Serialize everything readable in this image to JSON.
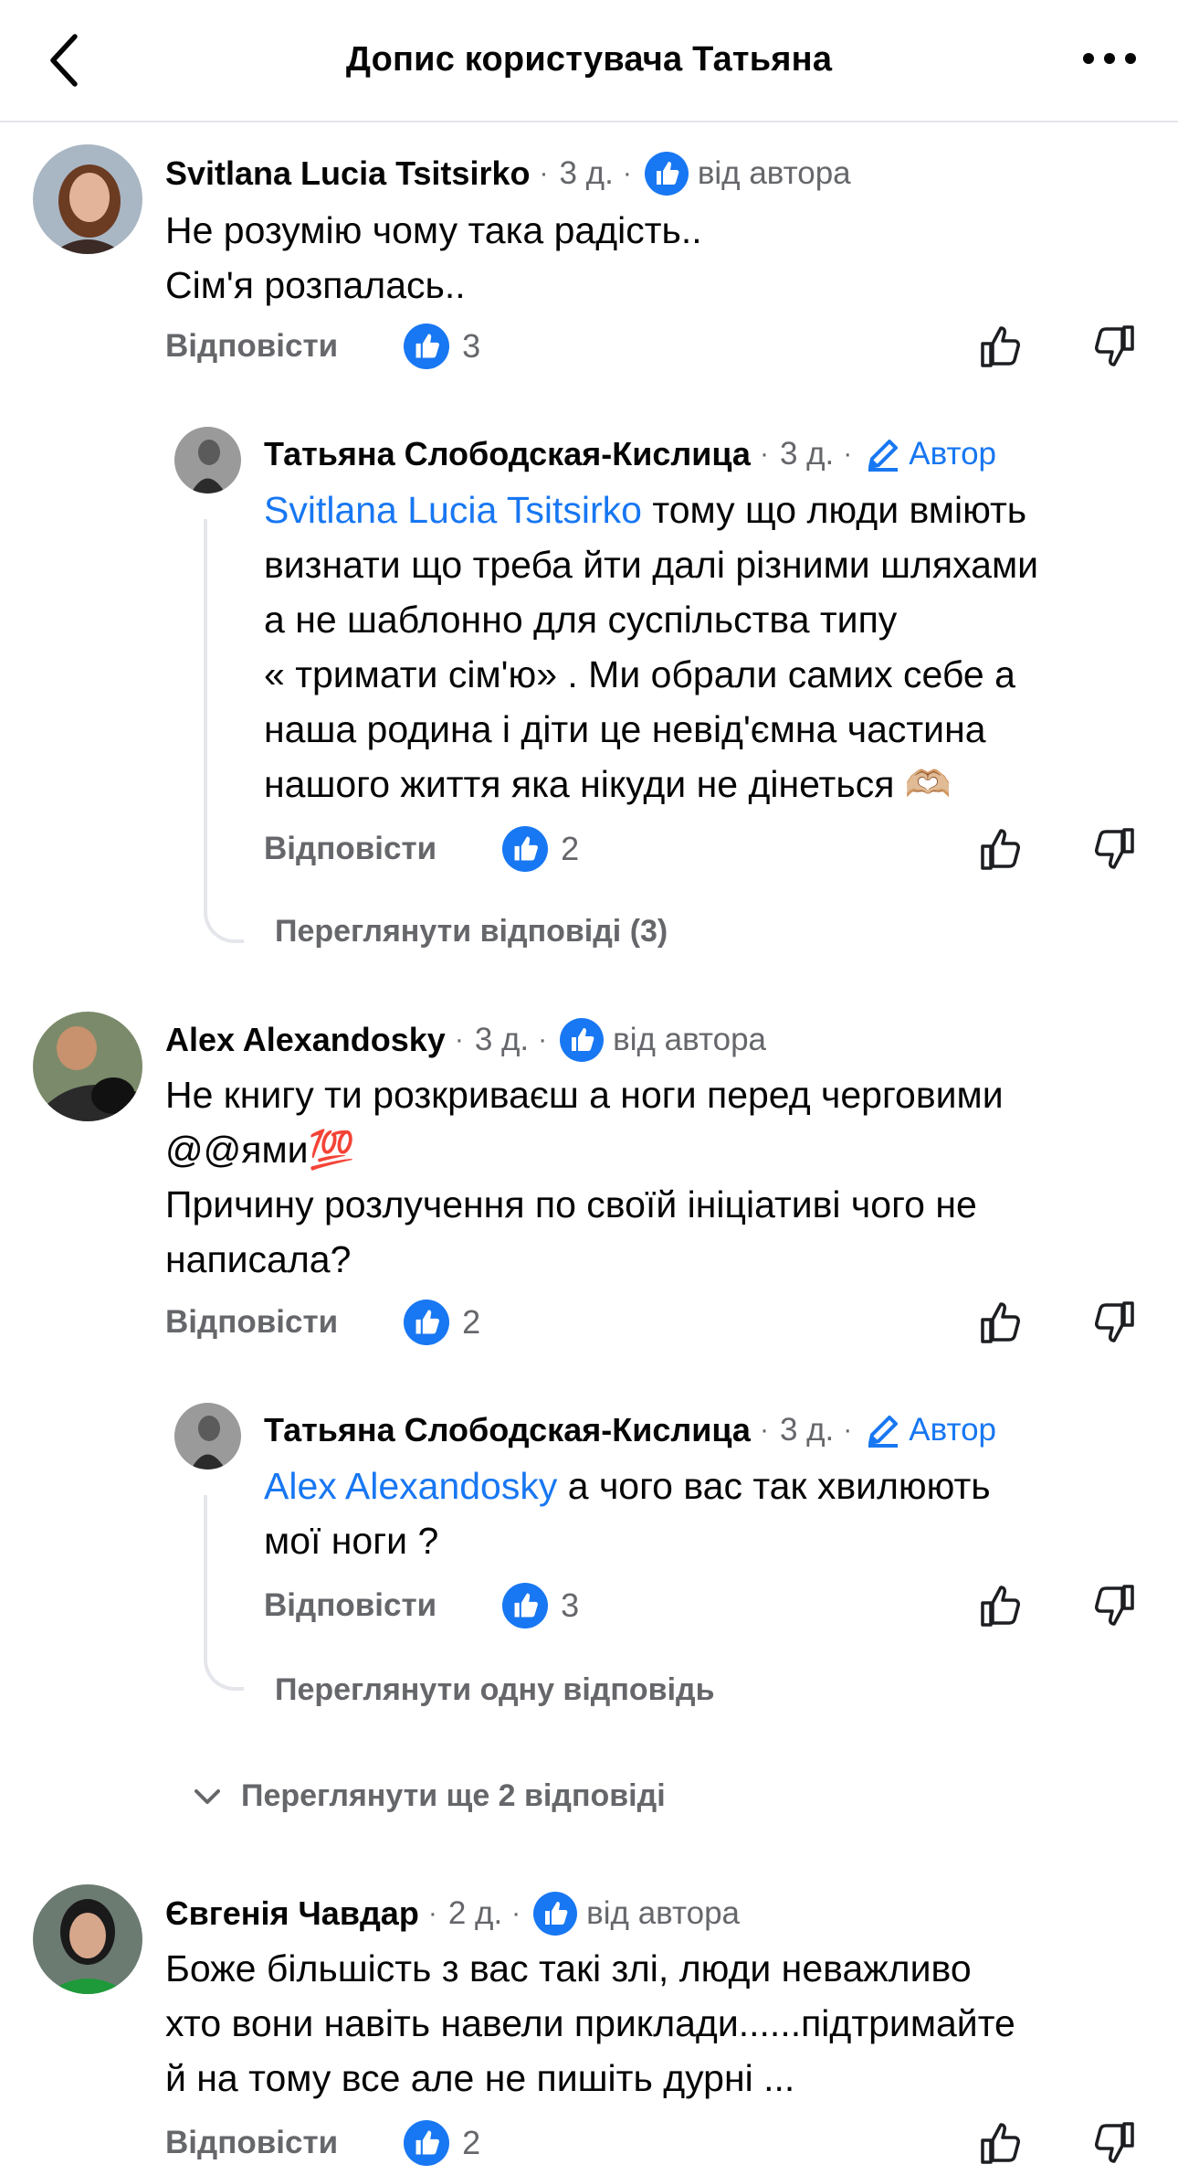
{
  "header": {
    "title": "Допис користувача Татьяна"
  },
  "labels": {
    "reply": "Відповісти",
    "from_author": "від автора",
    "author": "Автор"
  },
  "comments": [
    {
      "name": "Svitlana Lucia Tsitsirko",
      "time": "3 д.",
      "lines": [
        "Не розумію чому така радість..",
        "Сім'я розпалась.."
      ],
      "likes": "3"
    },
    {
      "name": "Татьяна Слободская-Кислица",
      "time": "3 д.",
      "mention": "Svitlana Lucia Tsitsirko",
      "line1_rest": " тому що люди вміють",
      "lines": [
        "визнати що треба йти далі різними шляхами",
        "а не шаблонно для суспільства типу",
        "« тримати сім'ю»   . Ми обрали самих себе а",
        "наша родина і діти це невід'ємна частина",
        "нашого життя яка нікуди не дінеться 🫶🏼"
      ],
      "likes": "2",
      "view_replies": "Переглянути відповіді (3)"
    },
    {
      "name": "Alex Alexandosky",
      "time": "3 д.",
      "lines": [
        "Не книгу ти розкриваєш а ноги перед черговими",
        "@@ями💯",
        "Причину розлучення по своїй ініціативі чого не",
        "написала?"
      ],
      "likes": "2"
    },
    {
      "name": "Татьяна Слободская-Кислица",
      "time": "3 д.",
      "mention": "Alex Alexandosky",
      "line1_rest": " а чого вас так хвилюють",
      "lines": [
        "мої ноги ?"
      ],
      "likes": "3",
      "view_replies": "Переглянути одну відповідь"
    },
    {
      "name": "Євгенія Чавдар",
      "time": "2 д.",
      "lines": [
        "Боже більшість з вас такі злі, люди неважливо",
        "хто вони навіть навели приклади......підтримайте",
        "й на тому все але не пишіть дурні ..."
      ],
      "likes": "2"
    }
  ],
  "more_replies": "Переглянути ще 2 відповіді",
  "colors": {
    "accent": "#1877f2",
    "secondary_text": "#65676b",
    "divider": "#e4e6eb"
  }
}
